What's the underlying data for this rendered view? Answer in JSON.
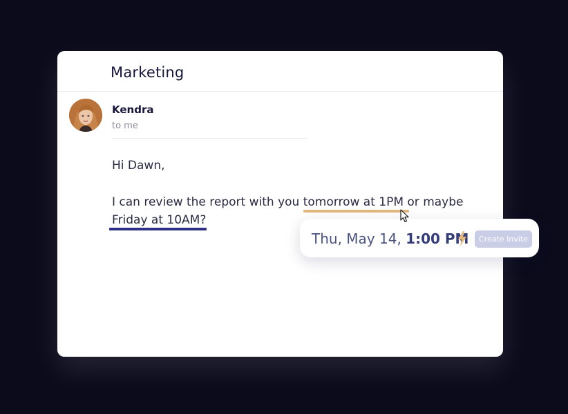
{
  "email": {
    "subject": "Marketing",
    "sender_name": "Kendra",
    "recipient": "to me",
    "greeting": "Hi Dawn,",
    "line1_pre": "I can review the report with you ",
    "line1_highlight": "tomorrow at 1PM",
    "line1_post": " or maybe",
    "line2_highlight": "Friday at 10AM?"
  },
  "popup": {
    "date": "Thu, May 14, ",
    "time": "1:00 PM",
    "button_label": "Create Invite"
  },
  "icons": {
    "cursor": "arrow-cursor-icon",
    "bolt": "lightning-bolt-icon"
  },
  "colors": {
    "background": "#0b0b1c",
    "highlight_orange": "#e3b87c",
    "highlight_blue": "#2f2f86",
    "button_bg": "#c9cde6",
    "bolt": "#e3b87c"
  }
}
